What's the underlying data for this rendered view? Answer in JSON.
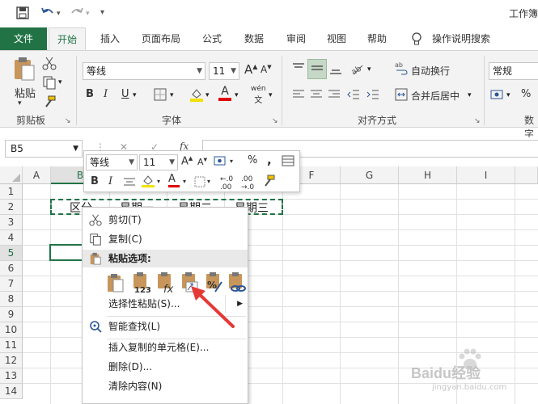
{
  "window": {
    "title": "工作簿"
  },
  "tabs": [
    {
      "label": "文件"
    },
    {
      "label": "开始"
    },
    {
      "label": "插入"
    },
    {
      "label": "页面布局"
    },
    {
      "label": "公式"
    },
    {
      "label": "数据"
    },
    {
      "label": "审阅"
    },
    {
      "label": "视图"
    },
    {
      "label": "帮助"
    },
    {
      "label": "操作说明搜索"
    }
  ],
  "ribbon": {
    "clipboard": {
      "paste_label": "粘贴",
      "group_label": "剪贴板"
    },
    "font": {
      "font_name": "等线",
      "font_size": "11",
      "group_label": "字体",
      "bold": "B",
      "italic": "I",
      "underline": "U",
      "font_color_letter": "A",
      "grow": "A",
      "shrink": "A",
      "phonetic": "wén"
    },
    "alignment": {
      "wrap_text": "自动换行",
      "merge_center": "合并后居中",
      "group_label": "对齐方式"
    },
    "number": {
      "format": "常规",
      "group_label": "数字",
      "percent": "%"
    }
  },
  "formula_bar": {
    "name_box": "B5",
    "fx": "fx",
    "cancel": "✕",
    "enter": "✓"
  },
  "sheet": {
    "columns": [
      "A",
      "B",
      "C",
      "D",
      "E",
      "F",
      "G",
      "H",
      "I"
    ],
    "rows": [
      "1",
      "2",
      "3",
      "4",
      "5",
      "6",
      "7",
      "8",
      "9",
      "10",
      "11",
      "12",
      "13",
      "14"
    ],
    "cells": {
      "b2": "区分",
      "c2": "星期一",
      "d2": "星期二",
      "e2": "星期三"
    }
  },
  "mini_toolbar": {
    "font_name": "等线",
    "font_size": "11",
    "bold": "B",
    "italic": "I",
    "percent": "%",
    "comma": ","
  },
  "context_menu": {
    "cut": "剪切(T)",
    "copy": "复制(C)",
    "paste_options": "粘贴选项:",
    "paste_special": "选择性粘贴(S)...",
    "smart_lookup": "智能查找(L)",
    "insert_copied": "插入复制的单元格(E)...",
    "delete": "删除(D)...",
    "clear": "清除内容(N)"
  },
  "watermark": {
    "text": "Baidu经验",
    "sub": "jingyan.baidu.com"
  },
  "colors": {
    "excel_green": "#217346",
    "ribbon_bg": "#f3f3f3",
    "arrow_red": "#e53935"
  }
}
